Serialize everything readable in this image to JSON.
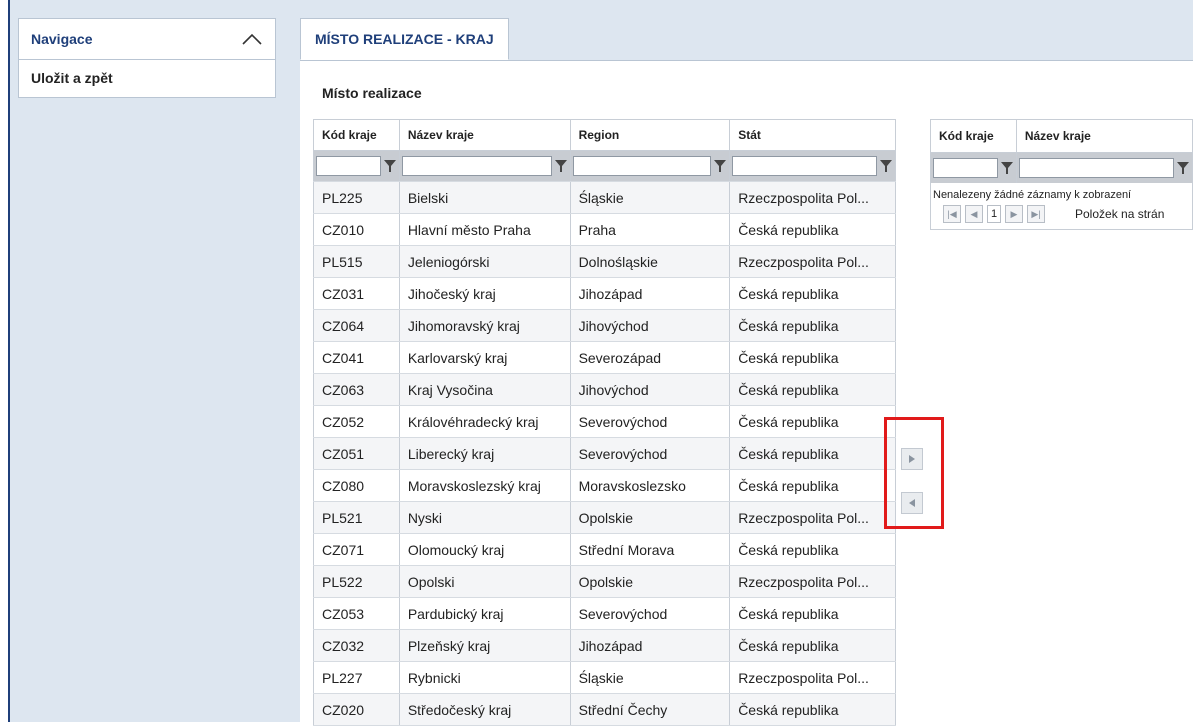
{
  "navigation": {
    "title": "Navigace",
    "items": [
      {
        "label": "Uložit a zpět"
      }
    ]
  },
  "tab": {
    "label": "MÍSTO REALIZACE - KRAJ"
  },
  "section": {
    "title": "Místo realizace"
  },
  "available_grid": {
    "columns": [
      "Kód kraje",
      "Název kraje",
      "Region",
      "Stát"
    ],
    "rows": [
      [
        "PL225",
        "Bielski",
        "Śląskie",
        "Rzeczpospolita Pol..."
      ],
      [
        "CZ010",
        "Hlavní město Praha",
        "Praha",
        "Česká republika"
      ],
      [
        "PL515",
        "Jeleniogórski",
        "Dolnośląskie",
        "Rzeczpospolita Pol..."
      ],
      [
        "CZ031",
        "Jihočeský kraj",
        "Jihozápad",
        "Česká republika"
      ],
      [
        "CZ064",
        "Jihomoravský kraj",
        "Jihovýchod",
        "Česká republika"
      ],
      [
        "CZ041",
        "Karlovarský kraj",
        "Severozápad",
        "Česká republika"
      ],
      [
        "CZ063",
        "Kraj Vysočina",
        "Jihovýchod",
        "Česká republika"
      ],
      [
        "CZ052",
        "Královéhradecký kraj",
        "Severovýchod",
        "Česká republika"
      ],
      [
        "CZ051",
        "Liberecký kraj",
        "Severovýchod",
        "Česká republika"
      ],
      [
        "CZ080",
        "Moravskoslezský kraj",
        "Moravskoslezsko",
        "Česká republika"
      ],
      [
        "PL521",
        "Nyski",
        "Opolskie",
        "Rzeczpospolita Pol..."
      ],
      [
        "CZ071",
        "Olomoucký kraj",
        "Střední Morava",
        "Česká republika"
      ],
      [
        "PL522",
        "Opolski",
        "Opolskie",
        "Rzeczpospolita Pol..."
      ],
      [
        "CZ053",
        "Pardubický kraj",
        "Severovýchod",
        "Česká republika"
      ],
      [
        "CZ032",
        "Plzeňský kraj",
        "Jihozápad",
        "Česká republika"
      ],
      [
        "PL227",
        "Rybnicki",
        "Śląskie",
        "Rzeczpospolita Pol..."
      ],
      [
        "CZ020",
        "Středočeský kraj",
        "Střední Čechy",
        "Česká republika"
      ]
    ]
  },
  "selected_grid": {
    "columns": [
      "Kód kraje",
      "Název kraje"
    ],
    "empty_message": "Nenalezeny žádné záznamy k zobrazení",
    "pager": {
      "page": "1",
      "label": "Položek na strán"
    }
  },
  "icons": {
    "nav_toggle": "chevron-up-icon",
    "filter": "filter-icon",
    "move_right": "arrow-right-icon",
    "move_left": "arrow-left-icon"
  },
  "colors": {
    "accent": "#1f3f7a",
    "highlight": "#e11a1a",
    "filter_bg": "#c8ccd2",
    "background": "#dde6f0"
  }
}
